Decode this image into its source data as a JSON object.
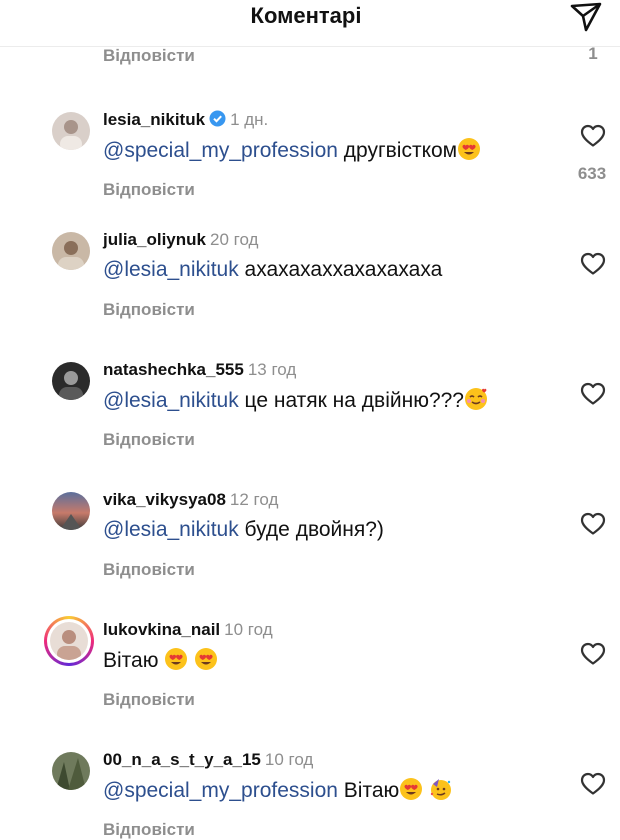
{
  "header": {
    "title": "Коментарі",
    "share_icon": "paper-plane-icon"
  },
  "reply_label": "Відповісти",
  "previous": {
    "like_count": "1"
  },
  "colors": {
    "mention": "#2d4f8e",
    "muted": "#8e8e8e",
    "verified": "#3897f0"
  },
  "comments": [
    {
      "username": "lesia_nikituk",
      "verified": true,
      "time": "1 дн.",
      "mention": "@special_my_profession",
      "text": " другвістком",
      "emojis": [
        "heart-eyes-emoji"
      ],
      "like_count": "633"
    },
    {
      "username": "julia_oliynuk",
      "verified": false,
      "time": "20 год",
      "mention": "@lesia_nikituk",
      "text": " ахахахаххахахахаха",
      "emojis": [],
      "like_count": ""
    },
    {
      "username": "natashechka_555",
      "verified": false,
      "time": "13 год",
      "mention": "@lesia_nikituk",
      "text": " це натяк на двійню???",
      "emojis": [
        "smiling-hearts-emoji"
      ],
      "like_count": ""
    },
    {
      "username": "vika_vikysya08",
      "verified": false,
      "time": "12 год",
      "mention": "@lesia_nikituk",
      "text": " буде двойня?)",
      "emojis": [],
      "like_count": ""
    },
    {
      "username": "lukovkina_nail",
      "verified": false,
      "time": "10 год",
      "mention": "",
      "text": "Вітаю ",
      "emojis": [
        "heart-eyes-emoji",
        "heart-eyes-emoji"
      ],
      "like_count": ""
    },
    {
      "username": "00_n_a_s_t_y_a_15",
      "verified": false,
      "time": "10 год",
      "mention": "@special_my_profession",
      "text": " Вітаю",
      "emojis": [
        "heart-eyes-emoji",
        "party-face-emoji"
      ],
      "like_count": ""
    }
  ]
}
